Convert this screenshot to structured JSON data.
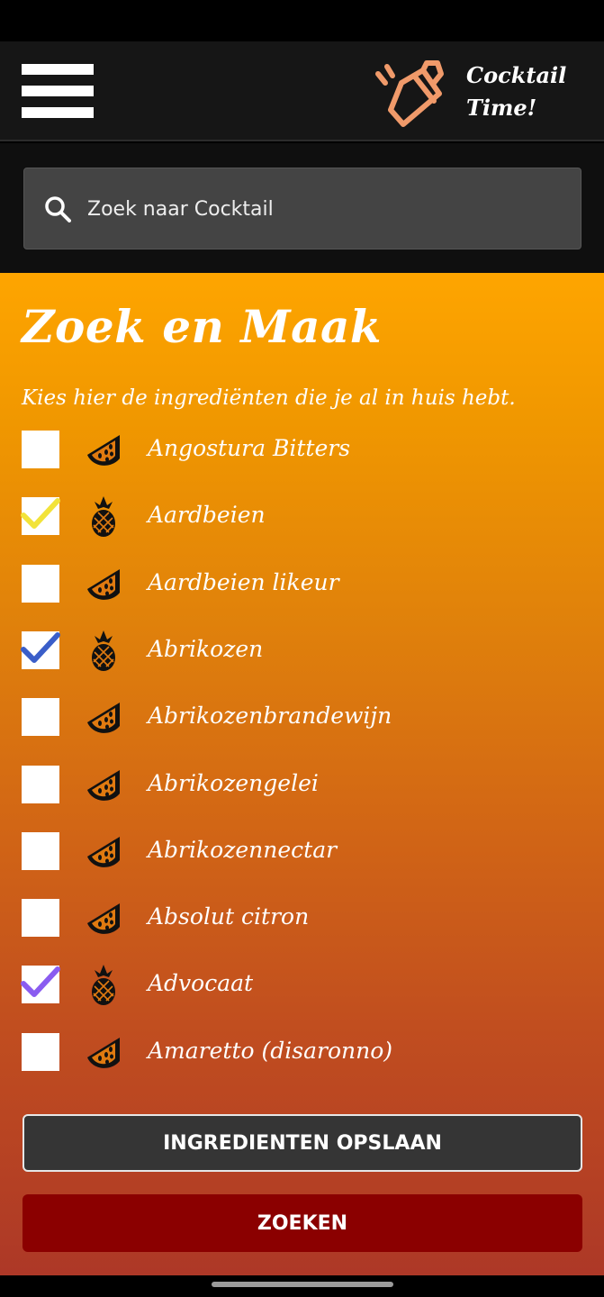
{
  "header": {
    "app_name_line1": "Cocktail",
    "app_name_line2": "Time!",
    "logo_color": "#f09a6a"
  },
  "search": {
    "placeholder": "Zoek naar Cocktail"
  },
  "main": {
    "title": "Zoek en Maak",
    "subtitle": "Kies hier de ingrediënten die je al in huis hebt.",
    "ingredients": [
      {
        "label": "Angostura Bitters",
        "icon": "watermelon-icon",
        "checked": false
      },
      {
        "label": "Aardbeien",
        "icon": "pineapple-icon",
        "checked": true,
        "check_color": "#f2e33a"
      },
      {
        "label": "Aardbeien likeur",
        "icon": "watermelon-icon",
        "checked": false
      },
      {
        "label": "Abrikozen",
        "icon": "pineapple-icon",
        "checked": true,
        "check_color": "#3a5ec9"
      },
      {
        "label": "Abrikozenbrandewijn",
        "icon": "watermelon-icon",
        "checked": false
      },
      {
        "label": "Abrikozengelei",
        "icon": "watermelon-icon",
        "checked": false
      },
      {
        "label": "Abrikozennectar",
        "icon": "watermelon-icon",
        "checked": false
      },
      {
        "label": "Absolut citron",
        "icon": "watermelon-icon",
        "checked": false
      },
      {
        "label": "Advocaat",
        "icon": "pineapple-icon",
        "checked": true,
        "check_color": "#8a5cf0"
      },
      {
        "label": "Amaretto (disaronno)",
        "icon": "watermelon-icon",
        "checked": false
      }
    ]
  },
  "buttons": {
    "save_label": "INGREDIENTEN OPSLAAN",
    "search_label": "ZOEKEN"
  }
}
